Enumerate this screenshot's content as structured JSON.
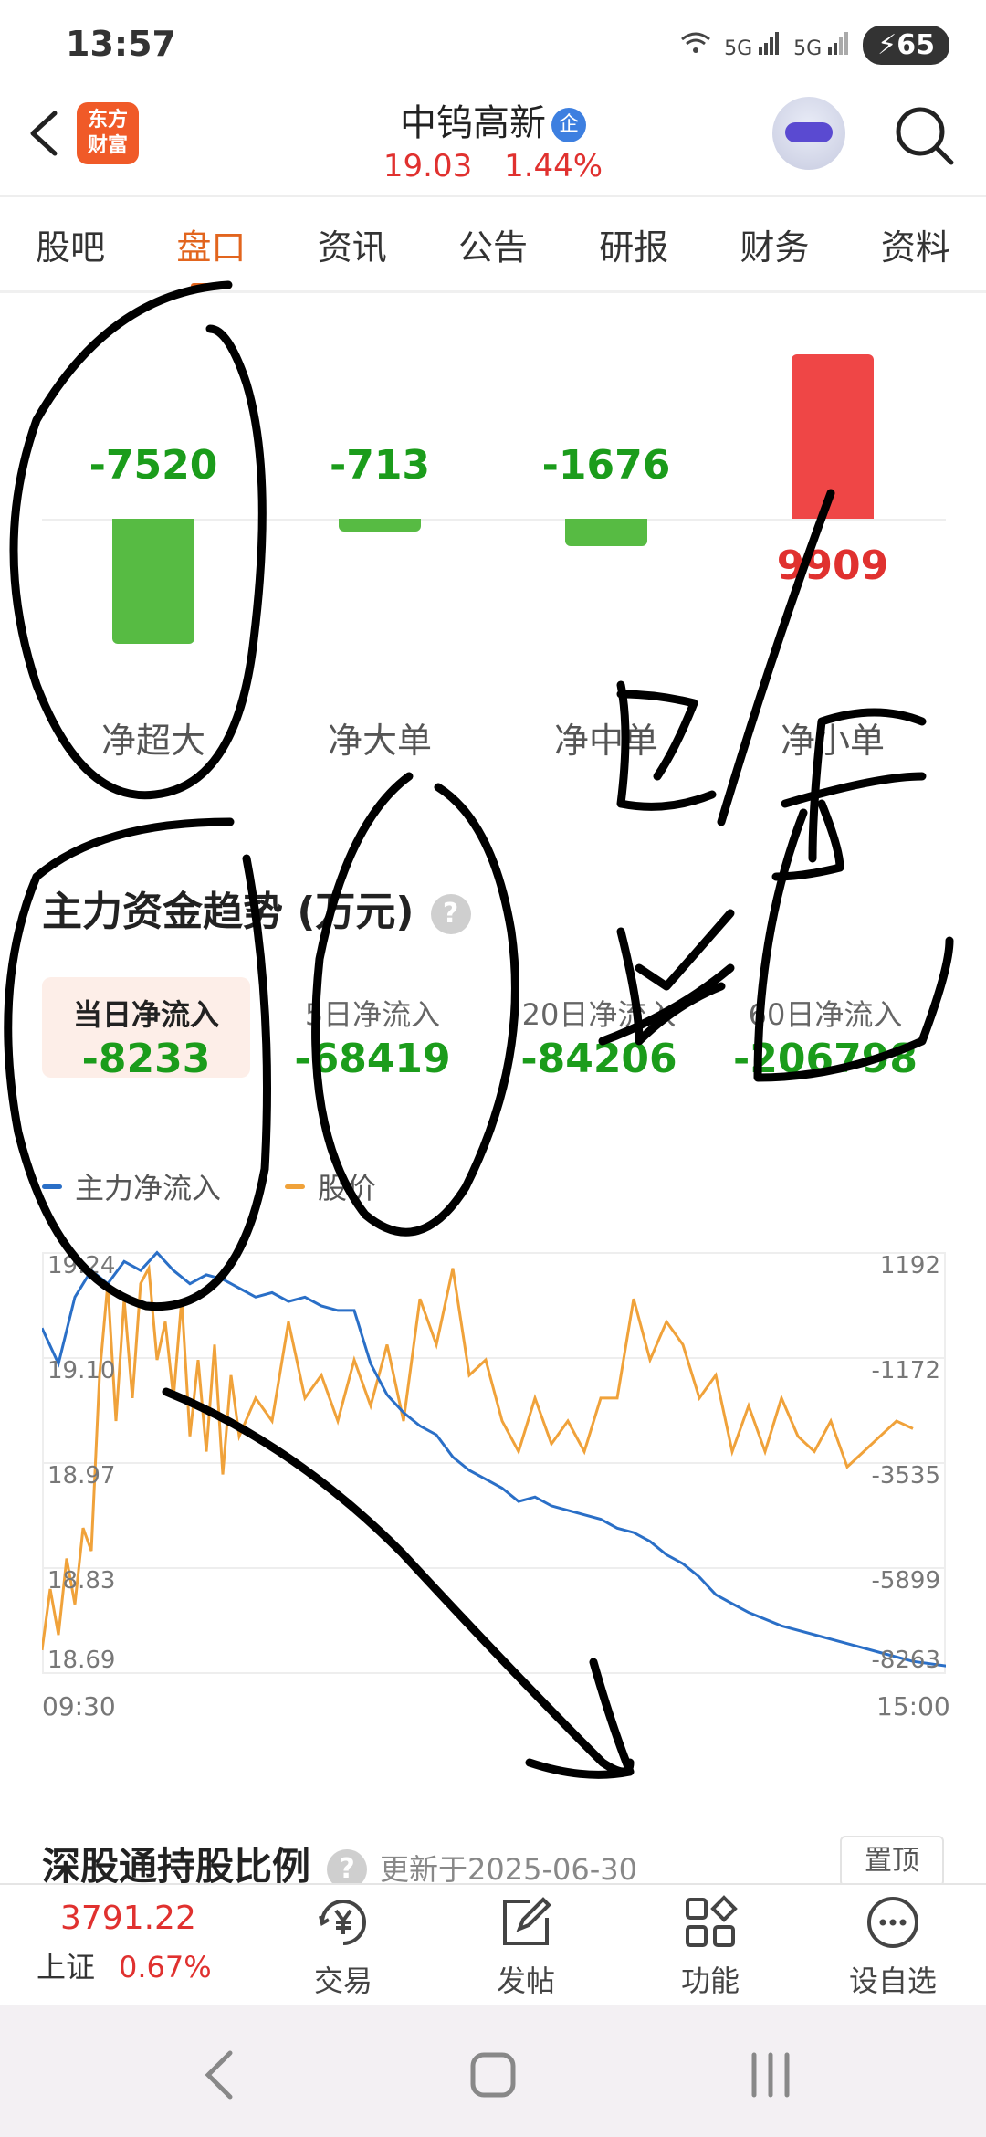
{
  "status_bar": {
    "time": "13:57",
    "signal1": "5G",
    "signal2": "5G",
    "battery": "65"
  },
  "header": {
    "logo_line1": "东方",
    "logo_line2": "财富",
    "stock_name": "中钨高新",
    "badge": "企",
    "price": "19.03",
    "change": "1.44%"
  },
  "tabs": [
    {
      "label": "股吧",
      "active": false
    },
    {
      "label": "盘口",
      "active": true
    },
    {
      "label": "资讯",
      "active": false
    },
    {
      "label": "公告",
      "active": false
    },
    {
      "label": "研报",
      "active": false
    },
    {
      "label": "财务",
      "active": false
    },
    {
      "label": "资料",
      "active": false
    }
  ],
  "flows": [
    {
      "label": "净超大",
      "value": "-7520",
      "color": "#57bb43"
    },
    {
      "label": "净大单",
      "value": "-713",
      "color": "#57bb43"
    },
    {
      "label": "净中单",
      "value": "-1676",
      "color": "#57bb43"
    },
    {
      "label": "净小单",
      "value": "9909",
      "color": "#ef4646"
    }
  ],
  "trend": {
    "title": "主力资金趋势 (万元)",
    "help": "?",
    "cards": [
      {
        "label": "当日净流入",
        "value": "-8233",
        "active": true
      },
      {
        "label": "5日净流入",
        "value": "-68419",
        "active": false
      },
      {
        "label": "20日净流入",
        "value": "-84206",
        "active": false
      },
      {
        "label": "60日净流入",
        "value": "-206798",
        "active": false
      }
    ],
    "legend_flow": "主力净流入",
    "legend_price": "股价",
    "color_flow": "#2a6fc7",
    "color_price": "#f0a23a"
  },
  "chart_data": {
    "type": "line",
    "x_range": [
      "09:30",
      "15:00"
    ],
    "left_axis_ticks": [
      "19.24",
      "19.10",
      "18.97",
      "18.83",
      "18.69"
    ],
    "right_axis_ticks": [
      "1192",
      "-1172",
      "-3535",
      "-5899",
      "-8263"
    ],
    "series": [
      {
        "name": "主力净流入",
        "x": [
          0,
          0.1,
          0.2,
          0.3,
          0.4,
          0.5,
          0.6,
          0.7,
          0.8,
          0.9,
          1.0,
          1.1,
          1.2,
          1.3,
          1.4,
          1.5,
          1.6,
          1.7,
          1.8,
          1.9,
          2.0,
          2.1,
          2.2,
          2.3,
          2.4,
          2.5,
          2.6,
          2.7,
          2.8,
          2.9,
          3.0,
          3.1,
          3.2,
          3.3,
          3.4,
          3.5,
          3.6,
          3.7,
          3.8,
          3.9,
          4.0,
          4.1,
          4.2,
          4.3,
          4.5,
          4.7,
          4.9,
          5.1,
          5.3,
          5.5,
          5.65
        ],
        "values": [
          -500,
          -1300,
          200,
          800,
          500,
          1000,
          800,
          1200,
          800,
          500,
          700,
          600,
          400,
          200,
          300,
          100,
          200,
          0,
          -100,
          -100,
          -1300,
          -2000,
          -2400,
          -2700,
          -2900,
          -3400,
          -3700,
          -3900,
          -4100,
          -4400,
          -4300,
          -4500,
          -4600,
          -4700,
          -4800,
          -5000,
          -5100,
          -5300,
          -5600,
          -5800,
          -6100,
          -6500,
          -6700,
          -6900,
          -7200,
          -7400,
          -7600,
          -7800,
          -8000,
          -8100,
          -8233
        ]
      },
      {
        "name": "股价",
        "x": [
          0,
          0.05,
          0.1,
          0.15,
          0.2,
          0.25,
          0.3,
          0.35,
          0.4,
          0.45,
          0.5,
          0.55,
          0.6,
          0.65,
          0.7,
          0.75,
          0.8,
          0.85,
          0.9,
          0.95,
          1.0,
          1.05,
          1.1,
          1.15,
          1.2,
          1.3,
          1.4,
          1.5,
          1.6,
          1.7,
          1.8,
          1.9,
          2.0,
          2.1,
          2.2,
          2.3,
          2.4,
          2.5,
          2.6,
          2.7,
          2.8,
          2.9,
          3.0,
          3.1,
          3.2,
          3.3,
          3.4,
          3.5,
          3.6,
          3.7,
          3.8,
          3.9,
          4.0,
          4.1,
          4.2,
          4.3,
          4.4,
          4.5,
          4.6,
          4.7,
          4.8,
          4.9,
          5.0,
          5.1,
          5.2,
          5.3
        ],
        "values": [
          18.72,
          18.8,
          18.74,
          18.84,
          18.78,
          18.88,
          18.85,
          19.08,
          19.2,
          19.02,
          19.18,
          19.05,
          19.2,
          19.22,
          19.1,
          19.15,
          19.05,
          19.18,
          19.0,
          19.1,
          18.98,
          19.12,
          18.95,
          19.08,
          19.0,
          19.05,
          19.02,
          19.15,
          19.05,
          19.08,
          19.02,
          19.1,
          19.04,
          19.12,
          19.02,
          19.18,
          19.12,
          19.22,
          19.08,
          19.1,
          19.02,
          18.98,
          19.05,
          18.99,
          19.02,
          18.98,
          19.05,
          19.05,
          19.18,
          19.1,
          19.15,
          19.12,
          19.05,
          19.08,
          18.98,
          19.04,
          18.98,
          19.05,
          19.0,
          18.98,
          19.02,
          18.96,
          18.98,
          19.0,
          19.02,
          19.01
        ]
      }
    ],
    "flow_ylim": [
      -8263,
      1192
    ],
    "price_ylim": [
      18.69,
      19.24
    ],
    "x_total": 5.5
  },
  "section2": {
    "title": "深股通持股比例",
    "help": "?",
    "updated": "更新于2025-06-30",
    "pin": "置顶"
  },
  "bottom_bar": {
    "index_value": "3791.22",
    "index_name": "上证",
    "index_change": "0.67%",
    "items": [
      {
        "label": "交易",
        "icon": "yen-icon"
      },
      {
        "label": "发帖",
        "icon": "edit-icon"
      },
      {
        "label": "功能",
        "icon": "grid-icon"
      },
      {
        "label": "设自选",
        "icon": "more-icon"
      }
    ]
  }
}
